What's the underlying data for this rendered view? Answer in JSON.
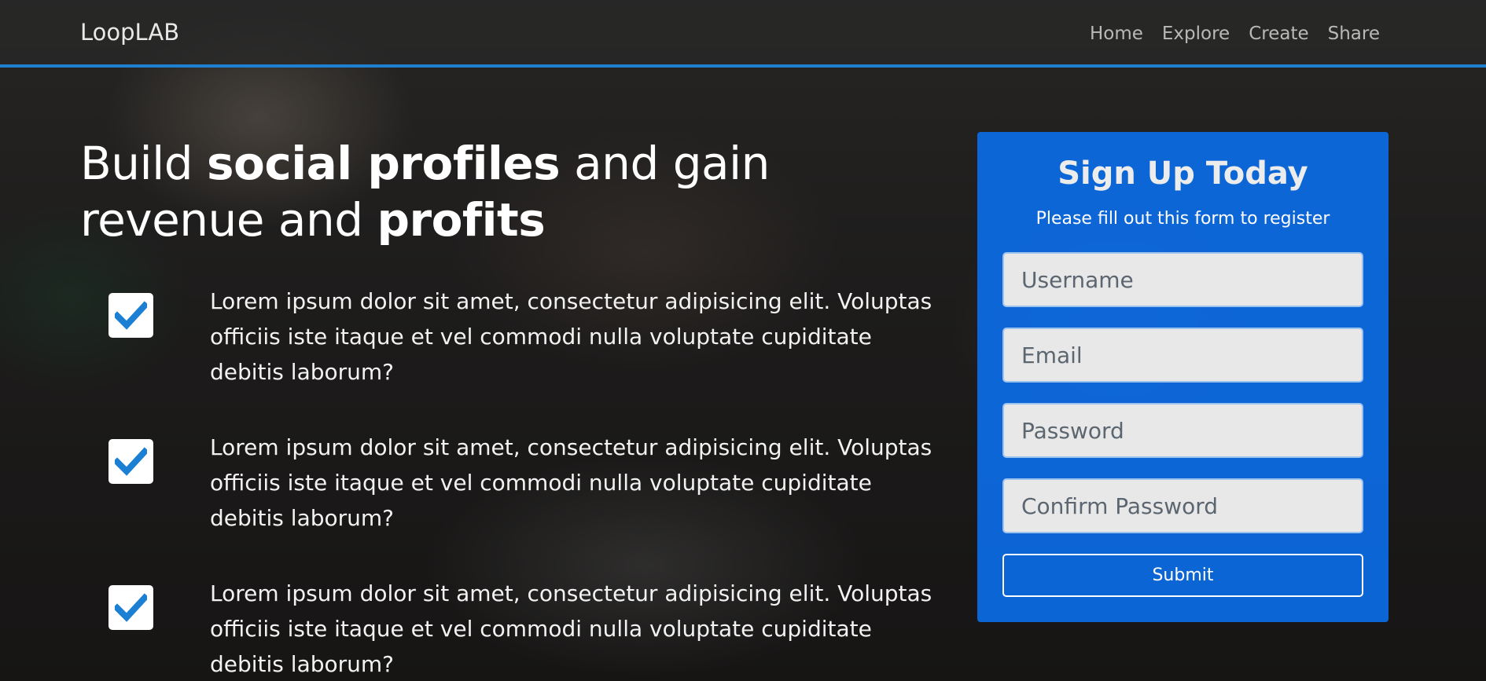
{
  "navbar": {
    "brand": "LoopLAB",
    "links": [
      "Home",
      "Explore",
      "Create",
      "Share"
    ]
  },
  "hero": {
    "headline_parts": [
      "Build ",
      "social profiles",
      " and gain revenue and ",
      "profits"
    ]
  },
  "features": [
    {
      "text": "Lorem ipsum dolor sit amet, consectetur adipisicing elit. Voluptas officiis iste itaque et vel commodi nulla voluptate cupiditate debitis laborum?",
      "icon": "check-icon"
    },
    {
      "text": "Lorem ipsum dolor sit amet, consectetur adipisicing elit. Voluptas officiis iste itaque et vel commodi nulla voluptate cupiditate debitis laborum?",
      "icon": "check-icon"
    },
    {
      "text": "Lorem ipsum dolor sit amet, consectetur adipisicing elit. Voluptas officiis iste itaque et vel commodi nulla voluptate cupiditate debitis laborum?",
      "icon": "check-icon"
    }
  ],
  "signup": {
    "title": "Sign Up Today",
    "subtitle": "Please fill out this form to register",
    "fields": [
      {
        "placeholder": "Username",
        "value": ""
      },
      {
        "placeholder": "Email",
        "value": ""
      },
      {
        "placeholder": "Password",
        "value": ""
      },
      {
        "placeholder": "Confirm Password",
        "value": ""
      }
    ],
    "submit_label": "Submit"
  },
  "colors": {
    "accent": "#1f7fd0",
    "panel": "#0c6ce6",
    "check": "#1b7fd4"
  }
}
